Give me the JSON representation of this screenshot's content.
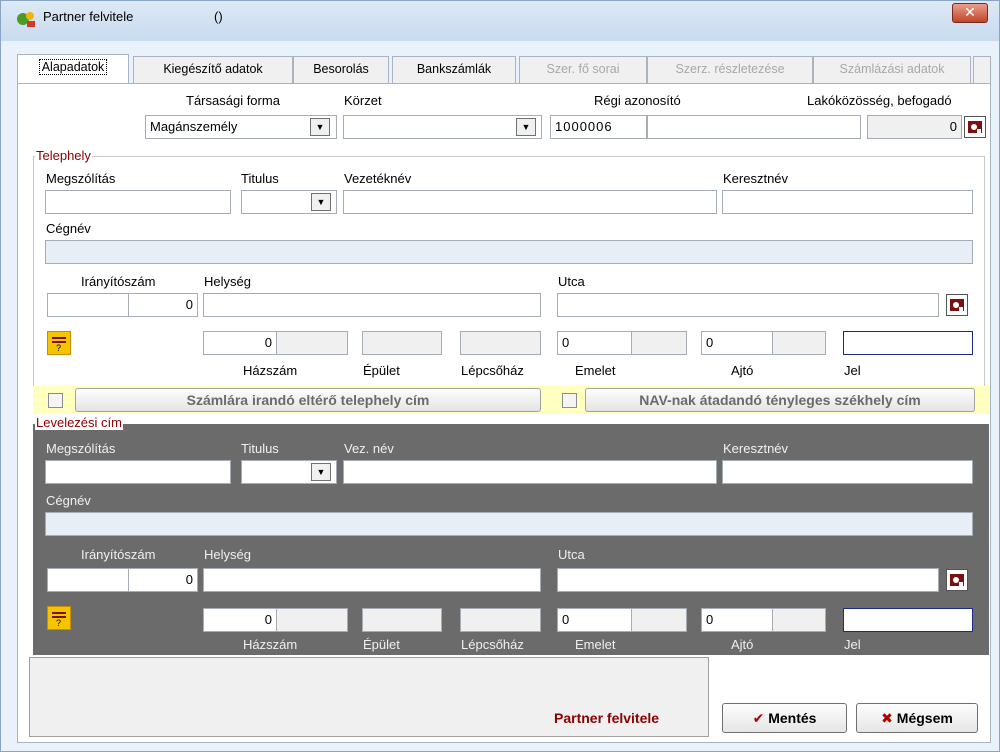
{
  "window": {
    "title": "Partner felvitele",
    "title_suffix": "()",
    "close_label": "✕"
  },
  "tabs": [
    {
      "label": "Alapadatok",
      "state": "active"
    },
    {
      "label": "Kiegészítő adatok",
      "state": "normal"
    },
    {
      "label": "Besorolás",
      "state": "normal"
    },
    {
      "label": "Bankszámlák",
      "state": "normal"
    },
    {
      "label": "Szer. fő sorai",
      "state": "disabled"
    },
    {
      "label": "Szerz. részletezése",
      "state": "disabled"
    },
    {
      "label": "Számlázási adatok",
      "state": "disabled"
    }
  ],
  "top": {
    "tarsasagi_forma_label": "Társasági forma",
    "tarsasagi_forma_value": "Magánszemély",
    "korzet_label": "Körzet",
    "korzet_value": "",
    "regi_azonosito_label": "Régi azonosító",
    "regi_azonosito_value": "1000006",
    "lakokozosseg_label": "Lakóközösség, befogadó",
    "lakokozosseg_value": "0"
  },
  "telephely": {
    "group_title": "Telephely",
    "megszolitas_label": "Megszólítás",
    "titulus_label": "Titulus",
    "vezeteknev_label": "Vezetéknév",
    "keresztnev_label": "Keresztnév",
    "cegnev_label": "Cégnév",
    "iranyitoszam_label": "Irányítószám",
    "iranyitoszam_value": "0",
    "helyseg_label": "Helység",
    "utca_label": "Utca",
    "hazszam_label": "Házszám",
    "hazszam_value": "0",
    "epulet_label": "Épület",
    "lepcsohaz_label": "Lépcsőház",
    "emelet_label": "Emelet",
    "emelet_value": "0",
    "ajto_label": "Ajtó",
    "ajto_value": "0",
    "jel_label": "Jel"
  },
  "checks": {
    "szamlara_label": "Számlára irandó eltérő telephely cím",
    "nav_label": "NAV-nak átadandó tényleges székhely cím"
  },
  "levelezesi": {
    "group_title": "Levelezési cím",
    "megszolitas_label": "Megszólítás",
    "titulus_label": "Titulus",
    "vez_nev_label": "Vez. név",
    "keresztnev_label": "Keresztnév",
    "cegnev_label": "Cégnév",
    "iranyitoszam_label": "Irányítószám",
    "iranyitoszam_value": "0",
    "helyseg_label": "Helység",
    "utca_label": "Utca",
    "hazszam_label": "Házszám",
    "hazszam_value": "0",
    "epulet_label": "Épület",
    "lepcsohaz_label": "Lépcsőház",
    "emelet_label": "Emelet",
    "emelet_value": "0",
    "ajto_label": "Ajtó",
    "ajto_value": "0",
    "jel_label": "Jel"
  },
  "footer": {
    "title": "Partner felvitele",
    "save_label": "Mentés",
    "save_icon": "✔",
    "cancel_label": "Mégsem",
    "cancel_icon": "✖"
  },
  "colors": {
    "accent_red": "#8b0000",
    "dark_panel": "#6b6b6b",
    "yellow_strip": "#ffffc0"
  }
}
